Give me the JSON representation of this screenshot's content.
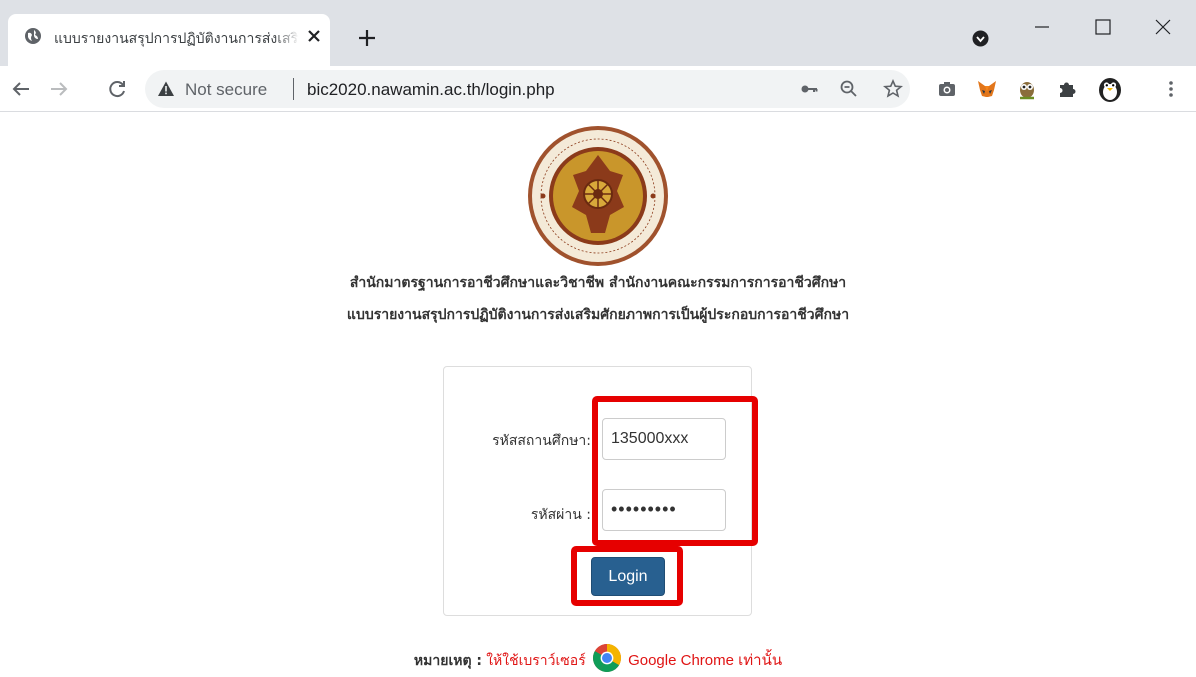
{
  "browser": {
    "tab_title": "แบบรายงานสรุปการปฏิบัติงานการส่งเสริมศักยภาพการเป็นผู้ประกอบการอาชีวศึกษา",
    "security_label": "Not secure",
    "url": "bic2020.nawamin.ac.th/login.php",
    "extensions": [
      "camera-icon",
      "metamask-fox-icon",
      "owl-icon",
      "puzzle-extensions-icon",
      "penguin-avatar-icon"
    ]
  },
  "page": {
    "heading_line1": "สำนักมาตรฐานการอาชีวศึกษาและวิชาชีพ สำนักงานคณะกรรมการการอาชีวศึกษา",
    "heading_line2": "แบบรายงานสรุปการปฏิบัติงานการส่งเสริมศักยภาพการเป็นผู้ประกอบการอาชีวศึกษา",
    "emblem": "vocational-education-commission-emblem"
  },
  "login_form": {
    "username_label": "รหัสสถานศึกษา:",
    "username_value": "135000xxx",
    "password_label": "รหัสผ่าน :",
    "password_value": "•••••••••",
    "submit_label": "Login"
  },
  "note": {
    "label": "หมายเหตุ :",
    "text": "ให้ใช้เบราว์เซอร์",
    "browser_name": "Google Chrome เท่านั้น"
  },
  "colors": {
    "highlight": "#e60000",
    "login_button": "#286090",
    "note_text": "#e01414"
  }
}
